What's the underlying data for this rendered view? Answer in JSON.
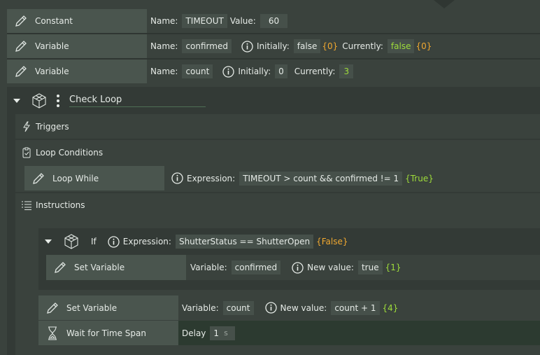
{
  "constant_row": {
    "title": "Constant",
    "name_label": "Name:",
    "name_value": "TIMEOUT",
    "value_label": "Value:",
    "value_value": "60"
  },
  "variable_confirmed": {
    "title": "Variable",
    "name_label": "Name:",
    "name_value": "confirmed",
    "initially_label": "Initially:",
    "initially_value": "false",
    "initially_hint": "{0}",
    "currently_label": "Currently:",
    "currently_value": "false",
    "currently_hint": "{0}"
  },
  "variable_count": {
    "title": "Variable",
    "name_label": "Name:",
    "name_value": "count",
    "initially_label": "Initially:",
    "initially_value": "0",
    "currently_label": "Currently:",
    "currently_value": "3"
  },
  "check_loop": {
    "title": "Check Loop",
    "triggers_label": "Triggers",
    "loop_conditions_label": "Loop Conditions",
    "loop_while": {
      "title": "Loop While",
      "expression_label": "Expression:",
      "expression_value": "TIMEOUT > count && confirmed != 1",
      "expression_hint": "{True}"
    },
    "instructions_label": "Instructions",
    "if_block": {
      "title": "If",
      "expression_label": "Expression:",
      "expression_value": "ShutterStatus == ShutterOpen",
      "expression_hint": "{False}",
      "set_variable": {
        "title": "Set Variable",
        "variable_label": "Variable:",
        "variable_value": "confirmed",
        "new_value_label": "New value:",
        "new_value": "true",
        "new_value_hint": "{1}"
      }
    },
    "set_variable_count": {
      "title": "Set Variable",
      "variable_label": "Variable:",
      "variable_value": "count",
      "new_value_label": "New value:",
      "new_value": "count + 1",
      "new_value_hint": "{4}"
    },
    "wait_time_span": {
      "title": "Wait for Time Span",
      "delay_label": "Delay",
      "delay_value": "1",
      "delay_unit": "s"
    }
  },
  "colors": {
    "background": "#3a423d",
    "label_box": "#4a554e",
    "field": "#46504a",
    "hint_orange": "#f0a830",
    "hint_green": "#9edc3a"
  },
  "icons": [
    "pencil-icon",
    "info-icon",
    "cube-icon",
    "kebab-menu-icon",
    "caret-down-icon",
    "lightning-icon",
    "clipboard-check-icon",
    "list-icon",
    "hourglass-icon"
  ]
}
